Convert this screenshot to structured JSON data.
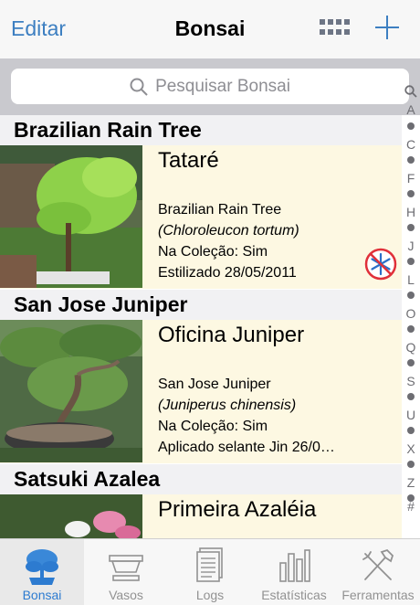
{
  "nav": {
    "edit_label": "Editar",
    "title": "Bonsai"
  },
  "search": {
    "placeholder": "Pesquisar Bonsai"
  },
  "sections": [
    {
      "header": "Brazilian Rain Tree",
      "item": {
        "name": "Tataré",
        "species": "Brazilian Rain Tree",
        "latin": "(Chloroleucon tortum)",
        "collection": "Na Coleção: Sim",
        "event": "Estilizado 28/05/2011",
        "frost_icon": "snowflake-no-icon"
      }
    },
    {
      "header": "San Jose Juniper",
      "item": {
        "name": "Oficina Juniper",
        "species": "San Jose Juniper",
        "latin": "(Juniperus chinensis)",
        "collection": "Na Coleção: Sim",
        "event": "Aplicado selante Jin 26/0…"
      }
    },
    {
      "header": "Satsuki Azalea",
      "item": {
        "name": "Primeira Azaléia"
      }
    }
  ],
  "index": [
    "A",
    "C",
    "F",
    "H",
    "J",
    "L",
    "O",
    "Q",
    "S",
    "U",
    "X",
    "Z",
    "#"
  ],
  "tabs": [
    {
      "label": "Bonsai",
      "icon": "tree-icon",
      "active": true
    },
    {
      "label": "Vasos",
      "icon": "pot-icon"
    },
    {
      "label": "Logs",
      "icon": "logs-icon"
    },
    {
      "label": "Estatísticas",
      "icon": "bar-chart-icon"
    },
    {
      "label": "Ferramentas",
      "icon": "tools-icon"
    }
  ],
  "colors": {
    "accent": "#3d7fc1",
    "row_bg": "#fdf8e2",
    "frost_red": "#e0303a"
  }
}
